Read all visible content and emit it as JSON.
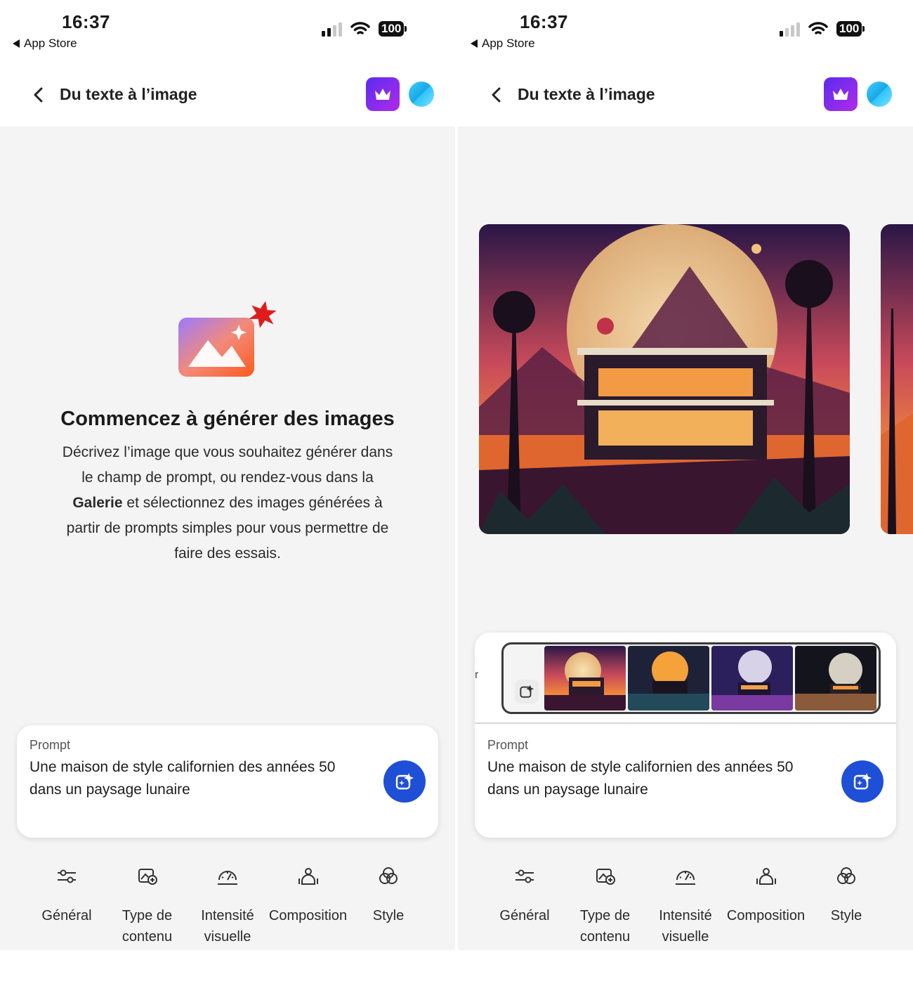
{
  "status": {
    "time": "16:37",
    "back_app": "App Store",
    "battery": "100"
  },
  "nav": {
    "title": "Du texte à l’image"
  },
  "empty_state": {
    "title": "Commencez à générer des images",
    "desc_part1": "Décrivez l’image que vous souhaitez générer dans le champ de prompt, ou rendez-vous dans la ",
    "desc_bold": "Galerie",
    "desc_part2": " et sélectionnez des images générées à partir de prompts simples pour vous permettre de faire des essais."
  },
  "prompt": {
    "label": "Prompt",
    "text": "Une maison de style californien des années 50 dans un paysage lunaire"
  },
  "strip": {
    "stray_char": "r"
  },
  "toolbar": {
    "general": "Général",
    "content_type": "Type de contenu",
    "visual_intensity": "Intensité visuelle",
    "composition": "Composition",
    "style": "Style"
  },
  "colors": {
    "accent": "#1f4fd6",
    "premium_from": "#5b2bf0",
    "premium_to": "#b02be8"
  },
  "icons": [
    "chevron-left-icon",
    "crown-icon",
    "avatar",
    "generate-sparkle-icon",
    "sliders-icon",
    "content-type-icon",
    "visual-intensity-icon",
    "composition-icon",
    "style-icon"
  ]
}
